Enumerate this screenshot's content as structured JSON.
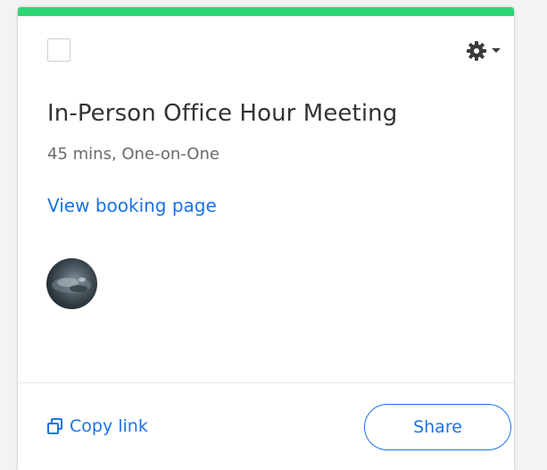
{
  "card": {
    "accent_color": "#2fd675",
    "title": "In-Person Office Hour Meeting",
    "details": "45 mins, One-on-One",
    "booking_link_label": "View booking page",
    "settings_icon": "gear-icon",
    "settings_dropdown_icon": "caret-down-icon",
    "checkbox_checked": false,
    "avatar": "user-avatar"
  },
  "footer": {
    "copy_link_icon": "copy-icon",
    "copy_link_label": "Copy link",
    "share_label": "Share"
  }
}
